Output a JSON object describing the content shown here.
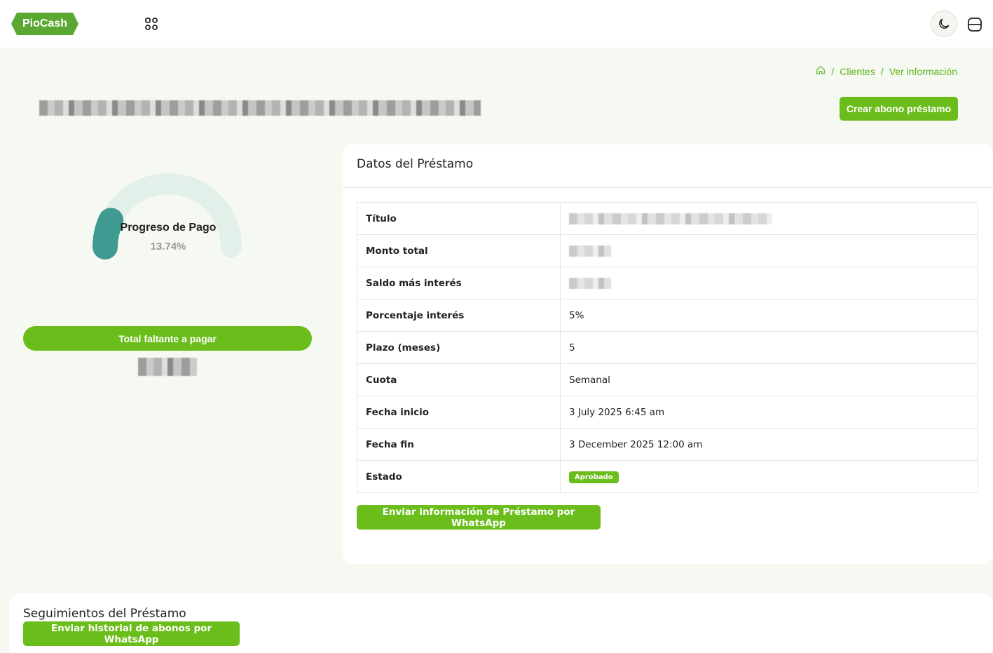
{
  "header": {
    "logo_text": "PioCash",
    "apps_icon": "apps-grid-icon",
    "theme_icon": "moon-icon",
    "panel_icon": "panel-toggle-icon"
  },
  "breadcrumb": {
    "home_icon": "home-icon",
    "items": [
      "Clientes",
      "Ver información"
    ],
    "separator": "/"
  },
  "page": {
    "create_button": "Crear abono préstamo"
  },
  "progress": {
    "title": "Progreso de Pago",
    "value_text": "13.74%",
    "value": 13.74,
    "total_label": "Total faltante a pagar"
  },
  "loan": {
    "title": "Datos del Préstamo",
    "rows": [
      {
        "label": "Título",
        "value": ""
      },
      {
        "label": "Monto total",
        "value": ""
      },
      {
        "label": "Saldo más interés",
        "value": ""
      },
      {
        "label": "Porcentaje interés",
        "value": "5%"
      },
      {
        "label": "Plazo (meses)",
        "value": "5"
      },
      {
        "label": "Cuota",
        "value": "Semanal"
      },
      {
        "label": "Fecha inicio",
        "value": "3 July 2025 6:45 am"
      },
      {
        "label": "Fecha fin",
        "value": "3 December 2025 12:00 am"
      },
      {
        "label": "Estado",
        "value": "Aprobado"
      }
    ],
    "whatsapp_button": "Enviar información de Préstamo por WhatsApp"
  },
  "tracking": {
    "title": "Seguimientos del Préstamo",
    "history_button": "Enviar historial de abonos por WhatsApp"
  },
  "colors": {
    "accent": "#6abd1a",
    "gauge_fill": "#3f9a92",
    "gauge_track": "#e3efe9"
  }
}
